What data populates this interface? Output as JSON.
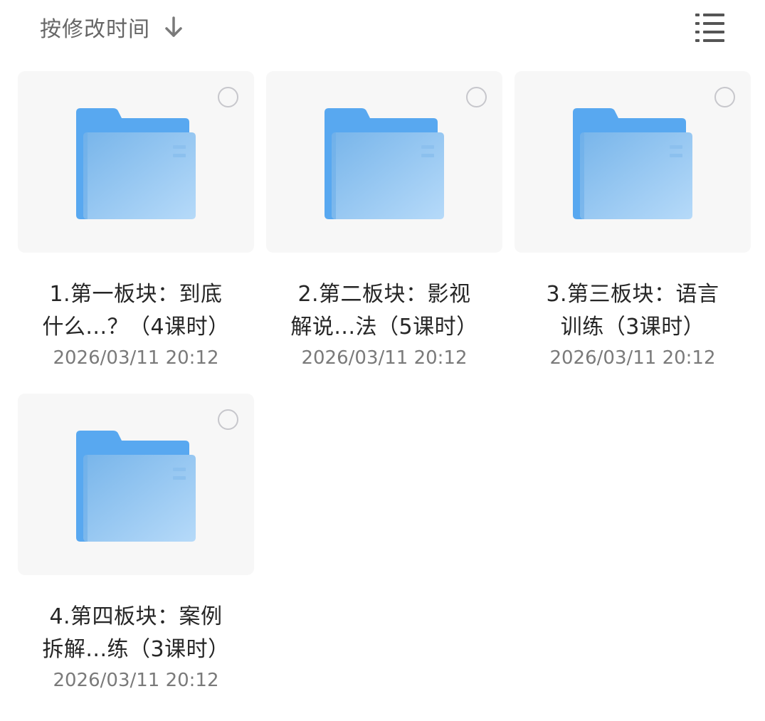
{
  "header": {
    "sort_label": "按修改时间",
    "sort_icon": "arrow-down-icon",
    "view_icon": "list-view-icon"
  },
  "colors": {
    "folder_back": "#58a8f0",
    "folder_front_start": "#7ab8ec",
    "folder_front_end": "#b4d8fb",
    "folder_notch": "#4c93db",
    "thumb_bg": "#f7f7f7",
    "select_circle": "#c7c7cc",
    "title_text": "#262626",
    "date_text": "#7a7a7a",
    "header_text": "#666666"
  },
  "folders": [
    {
      "name_line1": "1.第一板块：到底",
      "name_line2": "什么...？（4课时）",
      "date": "2026/03/11 20:12",
      "icon": "folder-icon"
    },
    {
      "name_line1": "2.第二板块：影视",
      "name_line2": "解说...法（5课时）",
      "date": "2026/03/11 20:12",
      "icon": "folder-icon"
    },
    {
      "name_line1": "3.第三板块：语言",
      "name_line2": "训练（3课时）",
      "date": "2026/03/11 20:12",
      "icon": "folder-icon"
    },
    {
      "name_line1": "4.第四板块：案例",
      "name_line2": "拆解...练（3课时）",
      "date": "2026/03/11 20:12",
      "icon": "folder-icon"
    }
  ]
}
